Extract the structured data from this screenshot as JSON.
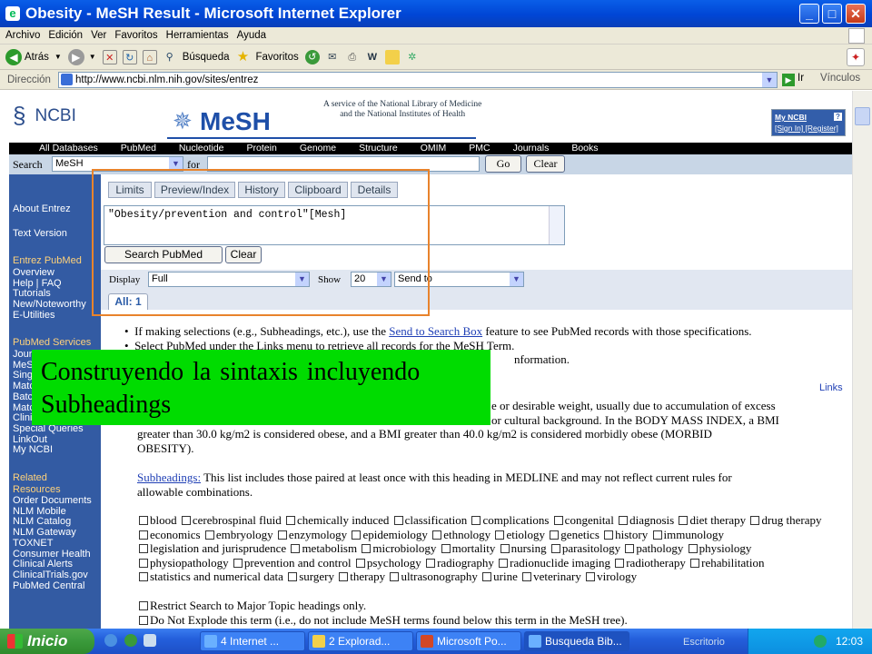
{
  "window": {
    "title": "Obesity - MeSH Result - Microsoft Internet Explorer",
    "controls": [
      "_",
      "□",
      "✕"
    ]
  },
  "menu": [
    "Archivo",
    "Edición",
    "Ver",
    "Favoritos",
    "Herramientas",
    "Ayuda"
  ],
  "toolbar": {
    "back": "Atrás",
    "search": "Búsqueda",
    "favorites": "Favoritos"
  },
  "address": {
    "label": "Dirección",
    "url": "http://www.ncbi.nlm.nih.gov/sites/entrez",
    "go": "Ir",
    "links": "Vínculos"
  },
  "page": {
    "ncbi": "NCBI",
    "mesh": "MeSH",
    "service_line1": "A service of the National Library of Medicine",
    "service_line2": "and the National Institutes of Health",
    "myncbi_title": "My NCBI",
    "myncbi_links": "[Sign In] [Register]",
    "nav": [
      "All Databases",
      "PubMed",
      "Nucleotide",
      "Protein",
      "Genome",
      "Structure",
      "OMIM",
      "PMC",
      "Journals",
      "Books"
    ],
    "search_label": "Search",
    "search_db": "MeSH",
    "for_label": "for",
    "go_btn": "Go",
    "clear_btn": "Clear",
    "tabs": [
      "Limits",
      "Preview/Index",
      "History",
      "Clipboard",
      "Details"
    ],
    "query": "\"Obesity/prevention and control\"[Mesh]",
    "search_pubmed_btn": "Search PubMed",
    "query_clear_btn": "Clear",
    "display_label": "Display",
    "display_value": "Full",
    "show_label": "Show",
    "show_value": "20",
    "send_value": "Send to",
    "all_tab": "All: 1",
    "sidebar": {
      "items1": [
        "About Entrez",
        "Text Version"
      ],
      "entrez_head": "Entrez PubMed",
      "entrez_items": [
        "Overview",
        "Help | FAQ",
        "Tutorials",
        "New/Noteworthy",
        "E-Utilities"
      ],
      "services_head": "PubMed Services",
      "services_items": [
        "Jour",
        "MeS",
        "Sing",
        "Matc",
        "Batc",
        "Matc",
        "Clini",
        "Special Queries",
        "LinkOut",
        "My NCBI"
      ],
      "related_head": "Related Resources",
      "related_items": [
        "Order Documents",
        "NLM Mobile",
        "NLM Catalog",
        "NLM Gateway",
        "TOXNET",
        "Consumer Health",
        "Clinical Alerts",
        "ClinicalTrials.gov",
        "PubMed Central"
      ]
    },
    "bullet1_pre": "If making selections (e.g., Subheadings, etc.), use the ",
    "bullet1_link": "Send to Search Box",
    "bullet1_post": " feature to see PubMed records with those specifications.",
    "bullet2": "Select PubMed under the Links menu to retrieve all records for the MeSH Term.",
    "bullet3_tail": "nformation.",
    "links_label": "Links",
    "def_line1": "e or desirable weight, usually due to accumulation of excess",
    "def_line2": "or cultural background. In the BODY MASS INDEX, a BMI",
    "def_line3": "greater than 30.0 kg/m2 is considered obese, and a BMI greater than 40.0 kg/m2 is considered morbidly obese (MORBID",
    "def_line4": "OBESITY).",
    "subheadings_link": "Subheadings:",
    "subheadings_text": " This list includes those paired at least once with this heading in MEDLINE and may not reflect current rules for",
    "subheadings_text2": "allowable combinations.",
    "subheadings": [
      "blood",
      "cerebrospinal fluid",
      "chemically induced",
      "classification",
      "complications",
      "congenital",
      "diagnosis",
      "diet therapy",
      "drug therapy",
      "economics",
      "embryology",
      "enzymology",
      "epidemiology",
      "ethnology",
      "etiology",
      "genetics",
      "history",
      "immunology",
      "legislation and jurisprudence",
      "metabolism",
      "microbiology",
      "mortality",
      "nursing",
      "parasitology",
      "pathology",
      "physiology",
      "physiopathology",
      "prevention and control",
      "psychology",
      "radiography",
      "radionuclide imaging",
      "radiotherapy",
      "rehabilitation",
      "statistics and numerical data",
      "surgery",
      "therapy",
      "ultrasonography",
      "urine",
      "veterinary",
      "virology"
    ],
    "restrict": "Restrict Search to Major Topic headings only.",
    "noexplode": "Do Not Explode this term (i.e., do not include MeSH terms found below this term in the MeSH tree)."
  },
  "overlay": {
    "line1": "Construyendo  la sintaxis  incluyendo",
    "line2": "Subheadings"
  },
  "taskbar": {
    "start": "Inicio",
    "tasks": [
      "4 Internet ...",
      "2 Explorad...",
      "Microsoft Po...",
      "Busqueda Bib..."
    ],
    "desktop": "Escritorio",
    "time": "12:03"
  },
  "colors": {
    "ncbi_blue": "#335ba3",
    "highlight_orange": "#e8832c",
    "overlay_green": "#00dc00"
  }
}
